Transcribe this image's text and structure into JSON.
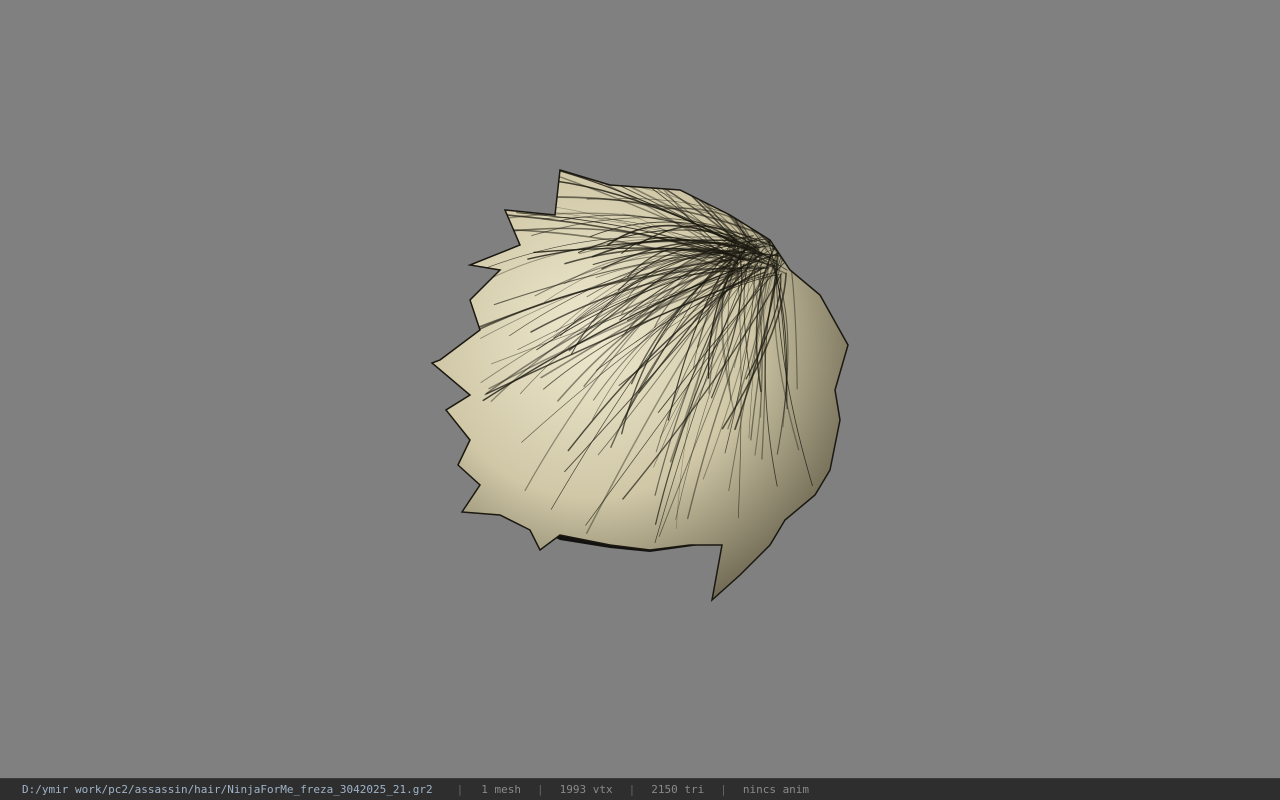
{
  "viewport": {
    "background": "#808080",
    "model_name": "hair-mesh"
  },
  "status_bar": {
    "file_path": "D:/ymir work/pc2/assassin/hair/NinjaForMe_freza_3042025_21.gr2",
    "separator": "|",
    "mesh_count": "1 mesh",
    "vertex_count": "1993 vtx",
    "triangle_count": "2150 tri",
    "anim_info": "nincs anim"
  },
  "colors": {
    "hair_base": "#e3ddc0",
    "hair_shadow": "#1c1a14",
    "statusbar_bg": "#2e2e2e"
  }
}
